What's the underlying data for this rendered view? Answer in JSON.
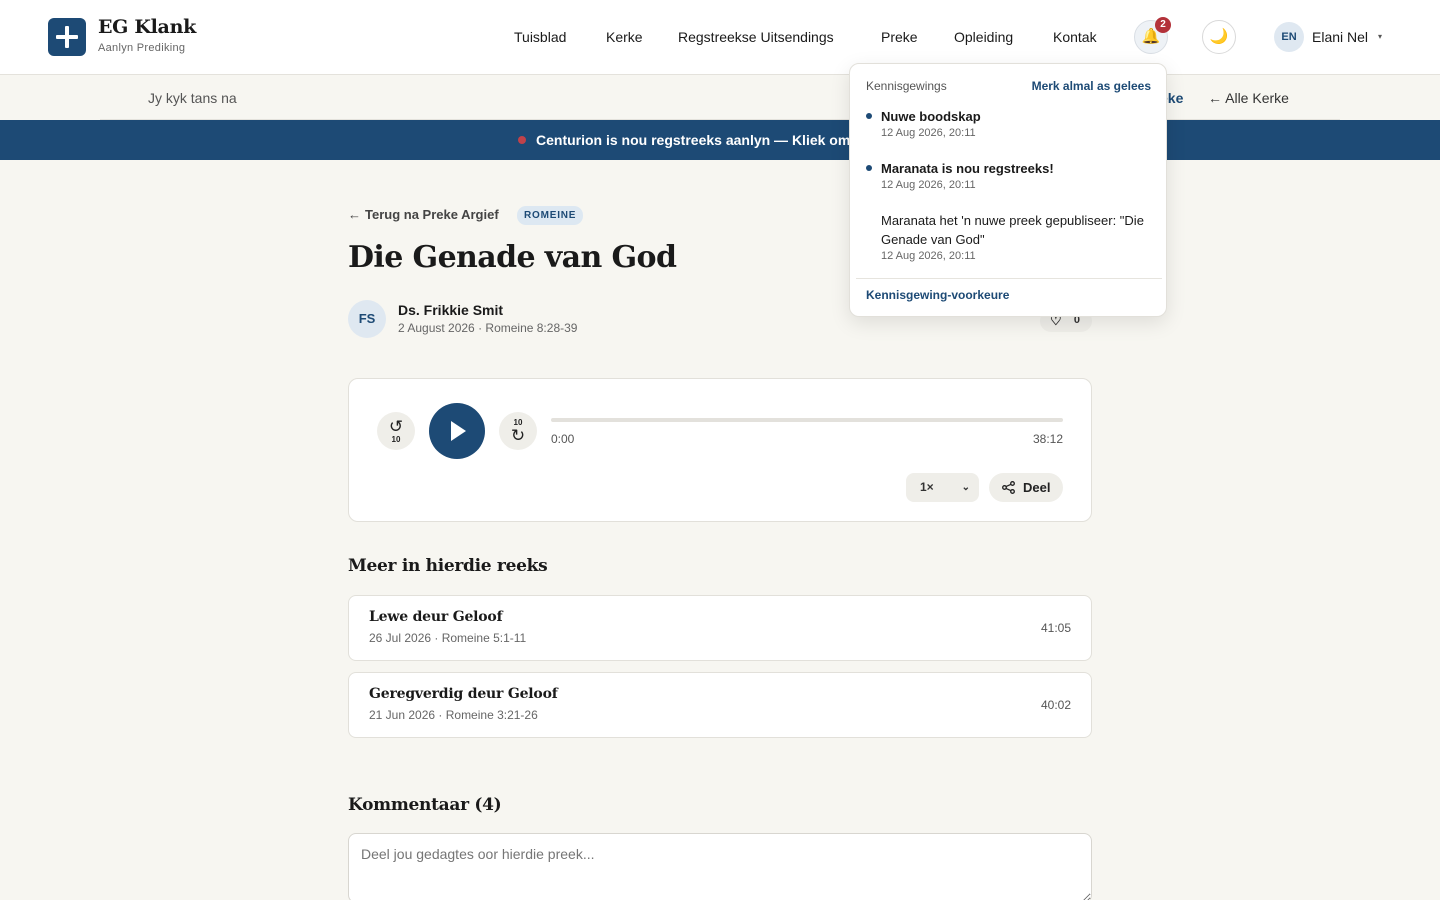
{
  "header": {
    "brand_title": "EG Klank",
    "brand_subtitle": "Aanlyn Prediking",
    "nav": [
      "Tuisblad",
      "Kerke",
      "Regstreekse Uitsendings",
      "Preke",
      "Opleiding",
      "Kontak"
    ],
    "notification_count": "2",
    "bell_icon": "🔔",
    "theme_icon": "🌙",
    "language": "EN",
    "user_name": "Elani Nel",
    "user_caret": "▾"
  },
  "subbar": {
    "watching_label": "Jy kyk tans na",
    "preke_link": "eke",
    "all_churches_link": "← Alle Kerke"
  },
  "live_banner": {
    "text": "Centurion is nou regstreeks aanlyn — Kliek om"
  },
  "sermon": {
    "back_arrow": "←",
    "back_label": "Terug na Preke Argief",
    "tag": "ROMEINE",
    "title": "Die Genade van God",
    "preacher_initials": "FS",
    "preacher": "Ds. Frikkie Smit",
    "meta": "2 August 2026 · Romeine 8:28-39",
    "likes": "0"
  },
  "player": {
    "rewind_seconds": "10",
    "forward_seconds": "10",
    "current_time": "0:00",
    "duration": "38:12",
    "progress": 0,
    "speed": "1×",
    "share_label": "Deel"
  },
  "series": {
    "heading": "Meer in hierdie reeks",
    "items": [
      {
        "title": "Lewe deur Geloof",
        "meta": "26 Jul 2026 · Romeine 5:1-11",
        "duration": "41:05"
      },
      {
        "title": "Geregverdig deur Geloof",
        "meta": "21 Jun 2026 · Romeine 3:21-26",
        "duration": "40:02"
      }
    ]
  },
  "comments": {
    "heading": "Kommentaar (4)",
    "placeholder": "Deel jou gedagtes oor hierdie preek..."
  },
  "notifications": {
    "heading": "Kennisgewings",
    "mark_all": "Merk almal as gelees",
    "items": [
      {
        "text": "Nuwe boodskap",
        "time": "12 Aug 2026, 20:11",
        "unread": true
      },
      {
        "text": "Maranata is nou regstreeks!",
        "time": "12 Aug 2026, 20:11",
        "unread": true
      },
      {
        "text": "Maranata het 'n nuwe preek gepubliseer: \"Die Genade van God\"",
        "time": "12 Aug 2026, 20:11",
        "unread": false
      }
    ],
    "preferences_link": "Kennisgewing-voorkeure"
  },
  "colors": {
    "primary": "#1d4a75",
    "badge": "#b3323a",
    "page_bg": "#f7f6f1"
  }
}
